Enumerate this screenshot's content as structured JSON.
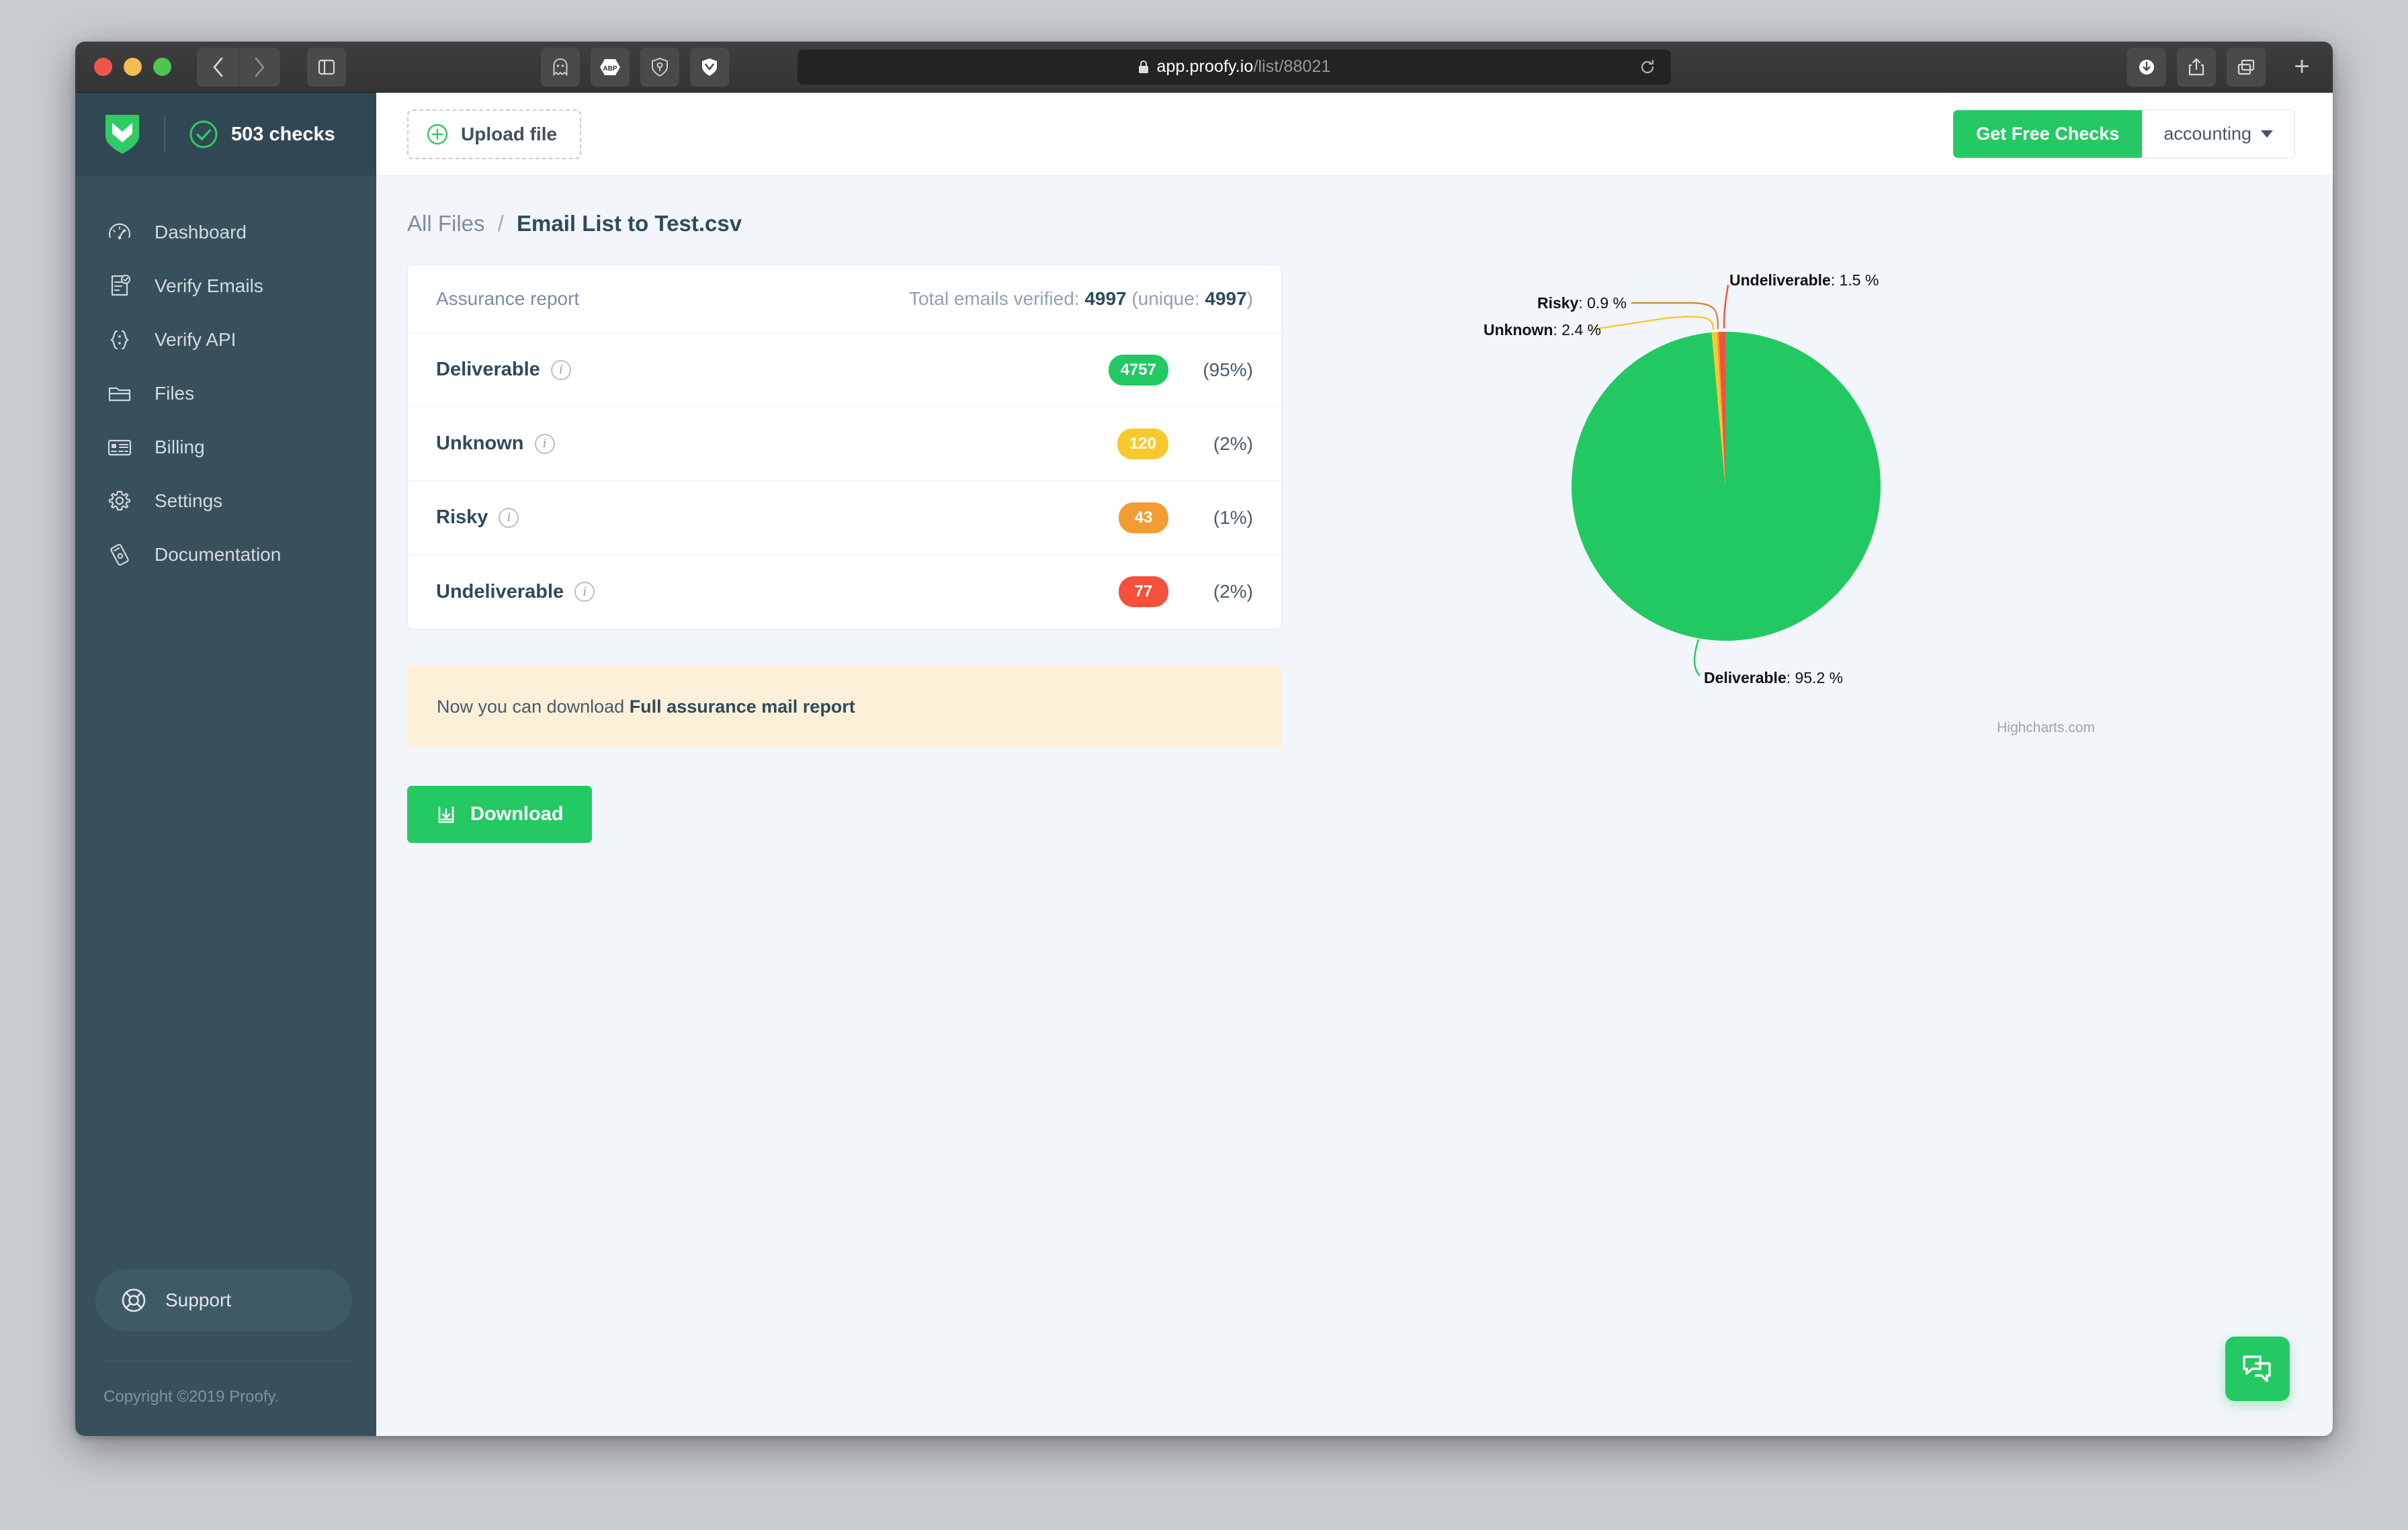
{
  "browser": {
    "url_domain": "app.proofy.io",
    "url_path": "/list/88021",
    "lock_icon": "lock-icon",
    "back_icon": "back-arrow-icon",
    "forward_icon": "forward-arrow-icon",
    "sidebar_icon": "sidebar-toggle-icon",
    "extensions": [
      "ghostery-icon",
      "adblock-plus-icon",
      "privacy-badger-icon",
      "shield-extension-icon"
    ],
    "extension_labels": {
      "adblock": "ABP"
    },
    "reload_icon": "reload-icon",
    "downloads_icon": "downloads-icon",
    "share_icon": "share-icon",
    "tabs_icon": "show-tabs-icon",
    "newtab_label": "+"
  },
  "sidebar": {
    "logo_icon": "proofy-shield-logo",
    "checks_icon": "check-circle-icon",
    "checks_label": "503 checks",
    "items": [
      {
        "label": "Dashboard",
        "icon": "speedometer-icon"
      },
      {
        "label": "Verify Emails",
        "icon": "document-check-icon"
      },
      {
        "label": "Verify API",
        "icon": "code-braces-icon"
      },
      {
        "label": "Files",
        "icon": "folder-icon"
      },
      {
        "label": "Billing",
        "icon": "credit-card-icon"
      },
      {
        "label": "Settings",
        "icon": "gear-icon"
      },
      {
        "label": "Documentation",
        "icon": "book-pen-icon"
      }
    ],
    "support_label": "Support",
    "support_icon": "lifebuoy-icon",
    "copyright": "Copyright ©2019 Proofy."
  },
  "topbar": {
    "upload_label": "Upload file",
    "upload_icon": "plus-circle-icon",
    "free_checks_label": "Get Free Checks",
    "account_label": "accounting"
  },
  "breadcrumb": {
    "parent": "All Files",
    "separator": "/",
    "current": "Email List to Test.csv"
  },
  "report": {
    "title": "Assurance report",
    "total_prefix": "Total emails verified:",
    "total_value": "4997",
    "unique_text": "(unique:",
    "unique_value": "4997",
    "unique_suffix": ")",
    "rows": [
      {
        "label": "Deliverable",
        "count": "4757",
        "percent": "(95%)",
        "color": "#22c962"
      },
      {
        "label": "Unknown",
        "count": "120",
        "percent": "(2%)",
        "color": "#f6ca2e"
      },
      {
        "label": "Risky",
        "count": "43",
        "percent": "(1%)",
        "color": "#f39c33"
      },
      {
        "label": "Undeliverable",
        "count": "77",
        "percent": "(2%)",
        "color": "#f4503c"
      }
    ]
  },
  "notice": {
    "text_before": "Now you can download ",
    "link_text": "Full assurance mail report"
  },
  "download": {
    "label": "Download",
    "icon": "download-tray-icon"
  },
  "chat": {
    "icon": "chat-bubbles-icon"
  },
  "chart_data": {
    "type": "pie",
    "title": "",
    "credit": "Highcharts.com",
    "legend_position": "none",
    "labels": [
      "Deliverable",
      "Unknown",
      "Risky",
      "Undeliverable"
    ],
    "values": [
      95.2,
      2.4,
      0.9,
      1.5
    ],
    "counts": [
      4757,
      120,
      43,
      77
    ],
    "colors": [
      "#22c962",
      "#f6ca2e",
      "#e2a13a",
      "#f4503c"
    ],
    "annotations": [
      {
        "label": "Undeliverable",
        "value": "1.5 %"
      },
      {
        "label": "Risky",
        "value": "0.9 %"
      },
      {
        "label": "Unknown",
        "value": "2.4 %"
      },
      {
        "label": "Deliverable",
        "value": "95.2 %"
      }
    ]
  }
}
